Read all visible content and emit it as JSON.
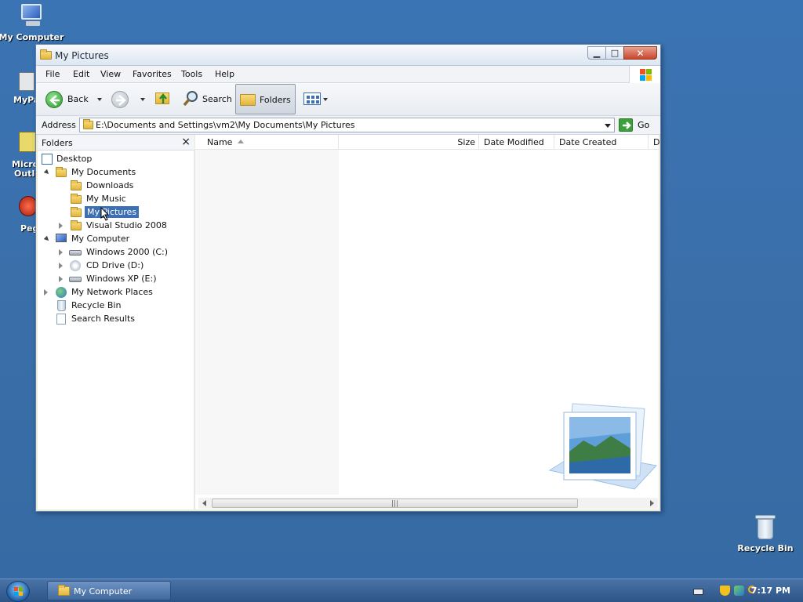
{
  "desktop": {
    "icons": {
      "my_computer": "My Computer",
      "recycle_bin": "Recycle Bin",
      "partial_1": "MyPa",
      "partial_2a": "Micro",
      "partial_2b": "Outlo",
      "partial_3": "Peg"
    }
  },
  "window": {
    "title": "My Pictures",
    "menu": [
      "File",
      "Edit",
      "View",
      "Favorites",
      "Tools",
      "Help"
    ],
    "toolbar": {
      "back_label": "Back",
      "search_label": "Search",
      "folders_label": "Folders"
    },
    "address": {
      "label": "Address",
      "value": "E:\\Documents and Settings\\vm2\\My Documents\\My Pictures",
      "go_label": "Go"
    },
    "folders_pane": {
      "title": "Folders",
      "close": "×",
      "tree": [
        "Desktop",
        "My Documents",
        "Downloads",
        "My Music",
        "My Pictures",
        "Visual Studio 2008",
        "My Computer",
        "Windows 2000 (C:)",
        "CD Drive (D:)",
        "Windows XP (E:)",
        "My Network Places",
        "Recycle Bin",
        "Search Results"
      ],
      "selected": "My Pictures"
    },
    "columns": [
      "Name",
      "Size",
      "Date Modified",
      "Date Created",
      "D"
    ]
  },
  "taskbar": {
    "task_label": "My Computer",
    "clock": "7:17 PM"
  },
  "colors": {
    "desktop": "#3a6ea5",
    "selection": "#3d6fb5",
    "close_button": "#c9452a"
  }
}
